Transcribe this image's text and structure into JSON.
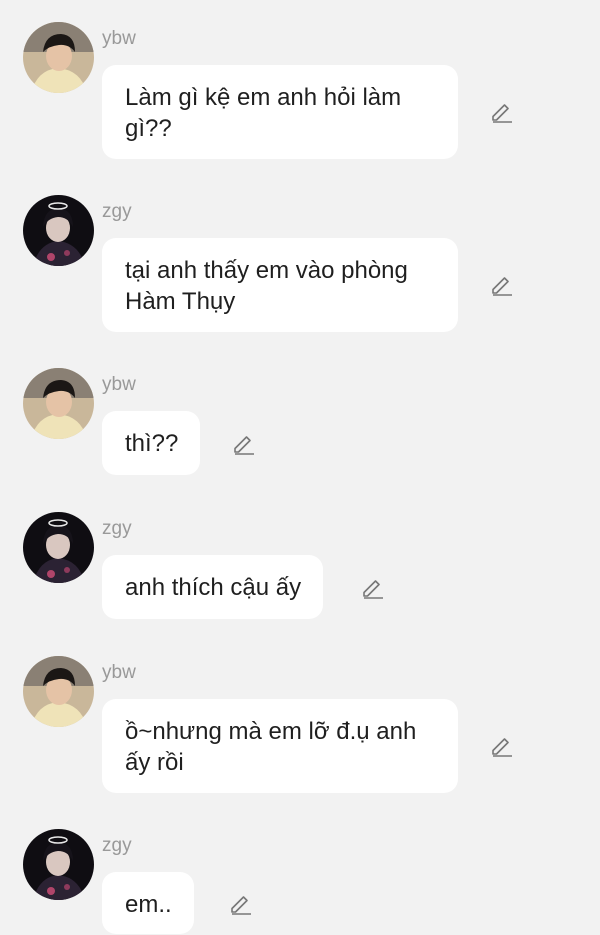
{
  "messages": [
    {
      "sender": "ybw",
      "text": "Làm gì kệ em anh hỏi làm gì??",
      "avatar_icon": "user-avatar-ybw-icon",
      "edit_icon": "pencil-edit-icon"
    },
    {
      "sender": "zgy",
      "text": "tại anh thấy em vào phòng Hàm Thụy",
      "avatar_icon": "user-avatar-zgy-icon",
      "edit_icon": "pencil-edit-icon"
    },
    {
      "sender": "ybw",
      "text": "thì??",
      "avatar_icon": "user-avatar-ybw-icon",
      "edit_icon": "pencil-edit-icon"
    },
    {
      "sender": "zgy",
      "text": "anh thích cậu ấy",
      "avatar_icon": "user-avatar-zgy-icon",
      "edit_icon": "pencil-edit-icon"
    },
    {
      "sender": "ybw",
      "text": "ồ~nhưng mà em lỡ đ.ụ anh ấy rồi",
      "avatar_icon": "user-avatar-ybw-icon",
      "edit_icon": "pencil-edit-icon"
    },
    {
      "sender": "zgy",
      "text": "em..",
      "avatar_icon": "user-avatar-zgy-icon",
      "edit_icon": "pencil-edit-icon"
    }
  ],
  "colors": {
    "background": "#f2f2f2",
    "bubble": "#ffffff",
    "sender_name": "#999999",
    "message_text": "#1f1f1f",
    "edit_icon": "#777777"
  }
}
